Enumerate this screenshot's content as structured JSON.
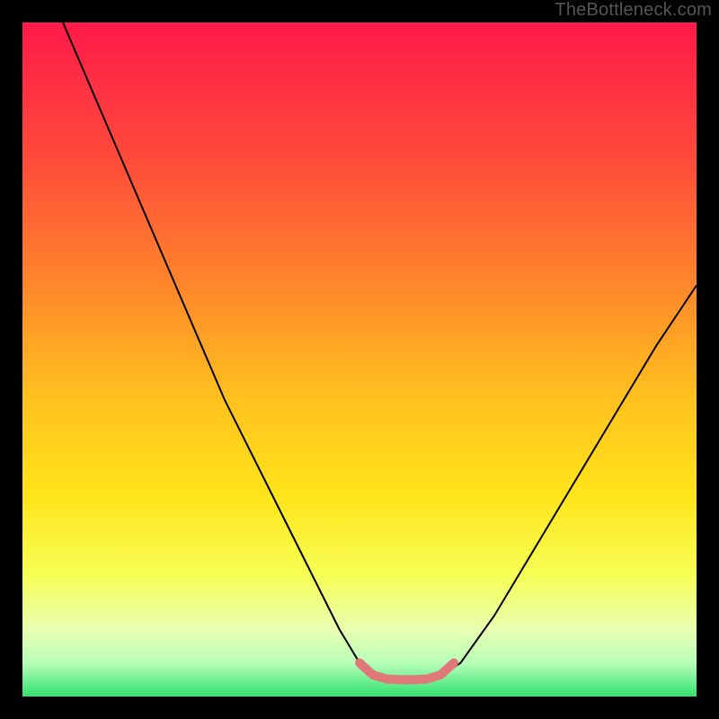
{
  "watermark": "TheBottleneck.com",
  "chart_data": {
    "type": "line",
    "title": "",
    "xlabel": "",
    "ylabel": "",
    "xlim": [
      0,
      100
    ],
    "ylim": [
      0,
      100
    ],
    "background": {
      "type": "vertical-gradient",
      "stops": [
        {
          "pos": 0.0,
          "color": "#ff1a4a"
        },
        {
          "pos": 0.2,
          "color": "#ff4a3a"
        },
        {
          "pos": 0.4,
          "color": "#ff8a2a"
        },
        {
          "pos": 0.55,
          "color": "#ffbf1f"
        },
        {
          "pos": 0.7,
          "color": "#ffe41a"
        },
        {
          "pos": 0.82,
          "color": "#f6ff55"
        },
        {
          "pos": 0.9,
          "color": "#e9ffb0"
        },
        {
          "pos": 0.95,
          "color": "#b8ffb8"
        },
        {
          "pos": 1.0,
          "color": "#30e070"
        }
      ]
    },
    "series": [
      {
        "name": "bottleneck-curve",
        "stroke": "#000000",
        "stroke_width": 2,
        "points": [
          {
            "x": 6,
            "y": 100
          },
          {
            "x": 12,
            "y": 86
          },
          {
            "x": 18,
            "y": 72
          },
          {
            "x": 24,
            "y": 58
          },
          {
            "x": 30,
            "y": 44
          },
          {
            "x": 36,
            "y": 32
          },
          {
            "x": 42,
            "y": 20
          },
          {
            "x": 47,
            "y": 10
          },
          {
            "x": 50,
            "y": 5
          },
          {
            "x": 53,
            "y": 3
          },
          {
            "x": 56,
            "y": 2.5
          },
          {
            "x": 59,
            "y": 2.5
          },
          {
            "x": 62,
            "y": 3
          },
          {
            "x": 65,
            "y": 5
          },
          {
            "x": 70,
            "y": 12
          },
          {
            "x": 76,
            "y": 22
          },
          {
            "x": 82,
            "y": 32
          },
          {
            "x": 88,
            "y": 42
          },
          {
            "x": 94,
            "y": 52
          },
          {
            "x": 100,
            "y": 61
          }
        ]
      },
      {
        "name": "valley-highlight",
        "stroke": "#e07878",
        "stroke_width": 10,
        "points": [
          {
            "x": 50,
            "y": 5
          },
          {
            "x": 52,
            "y": 3.2
          },
          {
            "x": 54,
            "y": 2.6
          },
          {
            "x": 56,
            "y": 2.5
          },
          {
            "x": 58,
            "y": 2.5
          },
          {
            "x": 60,
            "y": 2.6
          },
          {
            "x": 62,
            "y": 3.2
          },
          {
            "x": 64,
            "y": 5
          }
        ]
      }
    ]
  }
}
